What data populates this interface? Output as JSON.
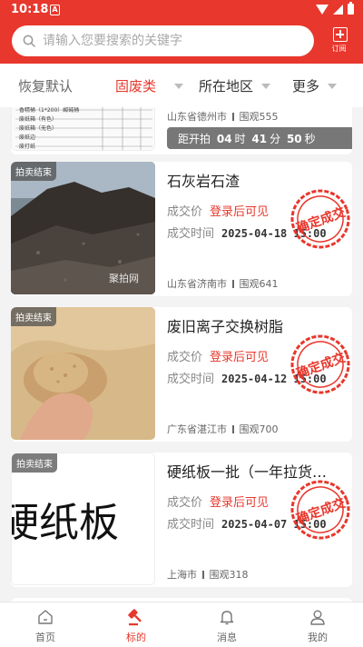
{
  "status_bar": {
    "time": "10:18",
    "icon_letter": "A"
  },
  "search": {
    "placeholder": "请输入您要搜索的关键字"
  },
  "subscribe": {
    "label": "订阅"
  },
  "filters": {
    "reset": "恢复默认",
    "category": "固废类",
    "region": "所在地区",
    "more": "更多"
  },
  "colors": {
    "brand": "#e8372c",
    "stamp": "#e8372c"
  },
  "list": {
    "top_card": {
      "location": "山东省德州市",
      "views": "围观555",
      "countdown": {
        "prefix": "距开拍",
        "days": "04",
        "days_unit": "时",
        "hours": "41",
        "hours_unit": "分",
        "minutes": "50",
        "minutes_unit": "秒"
      },
      "doc_lines": [
        "香精桶（1*200）酸碱桶",
        "废纸箱（有色）",
        "废纸箱（无色）",
        "废纸边",
        "废打纸"
      ]
    },
    "items": [
      {
        "badge": "拍卖结束",
        "title": "石灰岩石渣",
        "price_label": "成交价",
        "price_value": "登录后可见",
        "time_label": "成交时间",
        "time_value": "2025-04-18 15:00",
        "location": "山东省济南市",
        "views": "围观641",
        "stamp_text": "确定成交",
        "watermark": "聚拍网"
      },
      {
        "badge": "拍卖结束",
        "title": "废旧离子交换树脂",
        "price_label": "成交价",
        "price_value": "登录后可见",
        "time_label": "成交时间",
        "time_value": "2025-04-12 15:00",
        "location": "广东省湛江市",
        "views": "围观700",
        "stamp_text": "确定成交"
      },
      {
        "badge": "拍卖结束",
        "title": "硬纸板一批（一年拉货…",
        "price_label": "成交价",
        "price_value": "登录后可见",
        "time_label": "成交时间",
        "time_value": "2025-04-07 15:00",
        "location": "上海市",
        "views": "围观318",
        "stamp_text": "确定成交",
        "thumb_text": "硬纸板"
      }
    ]
  },
  "tabbar": {
    "home": "首页",
    "bids": "标的",
    "messages": "消息",
    "mine": "我的"
  }
}
